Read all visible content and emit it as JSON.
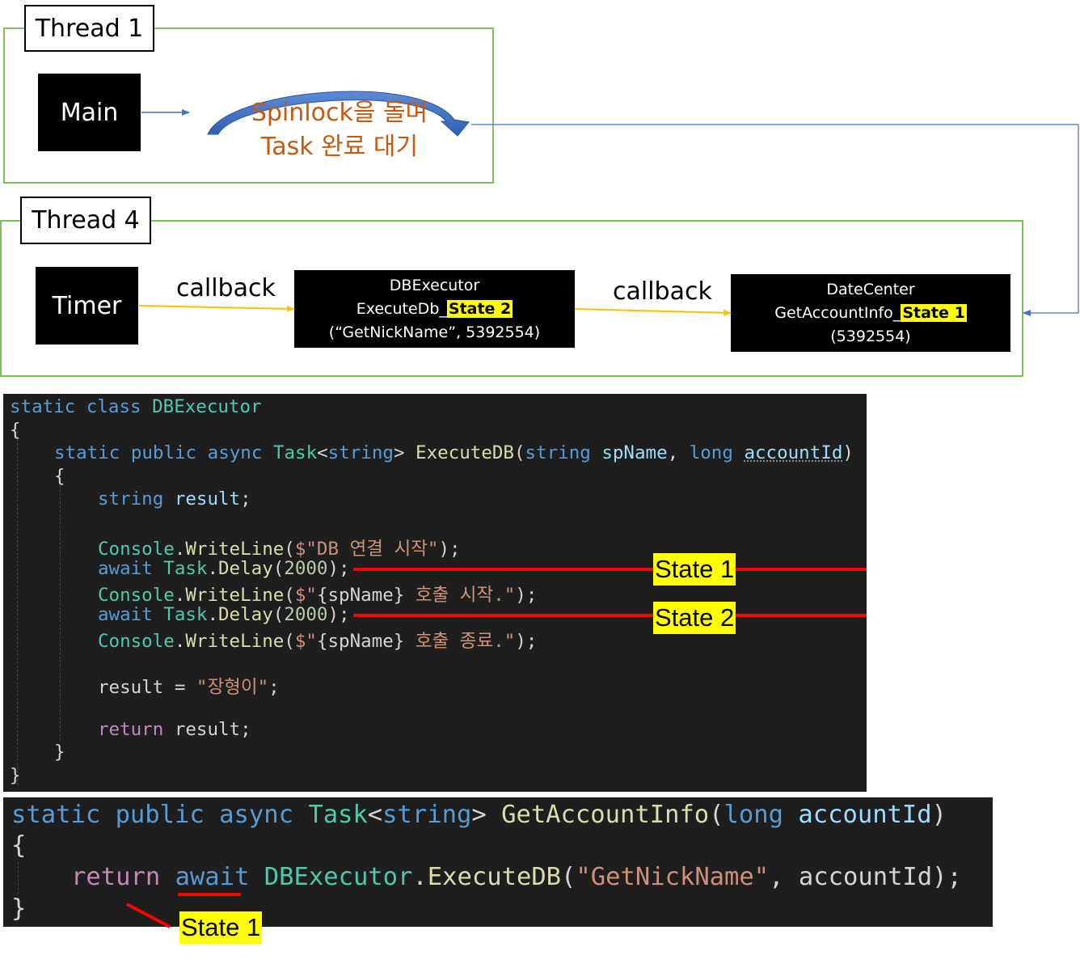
{
  "thread1": {
    "label": "Thread 1",
    "main_box": "Main",
    "spin_line1": "Spinlock을 돌며",
    "spin_line2": "Task 완료 대기"
  },
  "thread4": {
    "label": "Thread 4",
    "timer_box": "Timer",
    "callback1": "callback",
    "callback2": "callback",
    "dbexecutor": {
      "line1": "DBExecutor",
      "line2_prefix": "ExecuteDb_",
      "line2_state": "State 2",
      "line3": "(“GetNickName”, 5392554)"
    },
    "datecenter": {
      "line1": "DateCenter",
      "line2_prefix": "GetAccountInfo_",
      "line2_state": "State 1",
      "line3": "(5392554)"
    }
  },
  "colors": {
    "frame_green": "#7fbf5f",
    "arrow_blue": "#4472c4",
    "arrow_orange": "#ffc000",
    "spin_text": "#c55a11",
    "highlight": "#ffff00",
    "marker_red": "#ff0000",
    "code_bg": "#1e1e1e"
  },
  "code1": {
    "l1_kw1": "static",
    "l1_kw2": "class",
    "l1_type": "DBExecutor",
    "l2": "{",
    "l3_kw1": "static",
    "l3_kw2": "public",
    "l3_kw3": "async",
    "l3_type": "Task",
    "l3_lt": "<",
    "l3_generic": "string",
    "l3_gt": ">",
    "l3_fn": "ExecuteDB",
    "l3_open": "(",
    "l3_ptype1": "string",
    "l3_p1": "spName",
    "l3_comma": ",",
    "l3_ptype2": "long",
    "l3_p2": "accountId",
    "l3_close": ")",
    "l4": "{",
    "l5_type": "string",
    "l5_var": "result",
    "l5_semi": ";",
    "l6_cls": "Console",
    "l6_dot": ".",
    "l6_fn": "WriteLine",
    "l6_open": "(",
    "l6_str": "$\"DB 연결 시작\"",
    "l6_close": ");",
    "l7_kw": "await",
    "l7_cls": "Task",
    "l7_dot": ".",
    "l7_fn": "Delay",
    "l7_open": "(",
    "l7_num": "2000",
    "l7_close": ");",
    "l8_cls": "Console",
    "l8_dot": ".",
    "l8_fn": "WriteLine",
    "l8_open": "(",
    "l8_s1": "$\"",
    "l8_interp": "{spName}",
    "l8_s2": " 호출 시작.\"",
    "l8_close": ");",
    "l9_kw": "await",
    "l9_cls": "Task",
    "l9_dot": ".",
    "l9_fn": "Delay",
    "l9_open": "(",
    "l9_num": "2000",
    "l9_close": ");",
    "l10_cls": "Console",
    "l10_dot": ".",
    "l10_fn": "WriteLine",
    "l10_open": "(",
    "l10_s1": "$\"",
    "l10_interp": "{spName}",
    "l10_s2": " 호출 종료.\"",
    "l10_close": ");",
    "l11_var": "result",
    "l11_eq": " = ",
    "l11_str": "\"장형이\"",
    "l11_semi": ";",
    "l12_kw": "return",
    "l12_var": "result",
    "l12_semi": ";",
    "l13": "}",
    "l14": "}",
    "state1": "State 1",
    "state2": "State 2"
  },
  "code2": {
    "l1_kw1": "static",
    "l1_kw2": "public",
    "l1_kw3": "async",
    "l1_type": "Task",
    "l1_lt": "<",
    "l1_generic": "string",
    "l1_gt": ">",
    "l1_fn": "GetAccountInfo",
    "l1_open": "(",
    "l1_ptype": "long",
    "l1_param": "accountId",
    "l1_close": ")",
    "l2": "{",
    "l3_kw1": "return",
    "l3_kw2": "await",
    "l3_cls": "DBExecutor",
    "l3_dot": ".",
    "l3_fn": "ExecuteDB",
    "l3_open": "(",
    "l3_str": "\"GetNickName\"",
    "l3_comma": ",",
    "l3_arg": "accountId",
    "l3_close": ");",
    "l4": "}",
    "state1": "State 1"
  }
}
